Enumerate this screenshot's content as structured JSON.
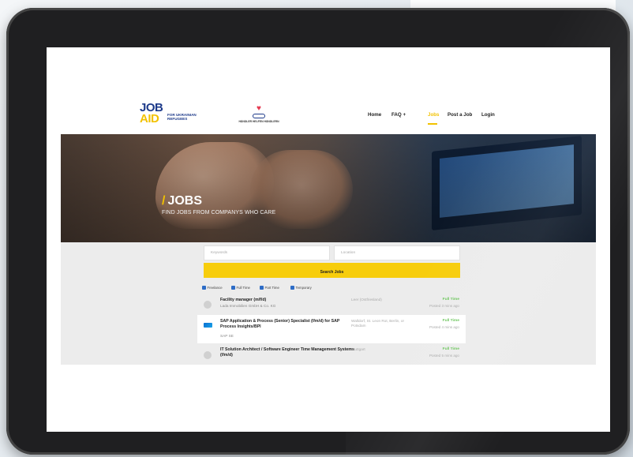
{
  "brand": {
    "logo_top": "JOB",
    "logo_bottom": "AID",
    "tagline_line1": "FOR UKRAINIAN",
    "tagline_line2": "REFUGEES",
    "partner_text": "HÄNDLER HELFEN HÄNDLERN",
    "accent_color": "#f2c200",
    "brand_color": "#1d3a8a"
  },
  "nav": {
    "items": [
      {
        "label": "Home"
      },
      {
        "label": "FAQ +"
      },
      {
        "label": "Jobs"
      },
      {
        "label": "Post a Job"
      },
      {
        "label": "Login"
      }
    ]
  },
  "hero": {
    "slash": "/",
    "title": "JOBS",
    "subtitle": "FIND JOBS FROM COMPANYS WHO CARE"
  },
  "search": {
    "keywords_placeholder": "Keywords",
    "location_placeholder": "Location",
    "button_label": "Search Jobs"
  },
  "filters": [
    {
      "label": "Freelance",
      "checked": true
    },
    {
      "label": "Full Time",
      "checked": true
    },
    {
      "label": "Part Time",
      "checked": true
    },
    {
      "label": "Temporary",
      "checked": true
    }
  ],
  "jobs": [
    {
      "title": "Facility manager (m/f/d)",
      "company": "Lada Immobilien GmbH & Co. KG",
      "location": "Leer (Ostfriesland)",
      "type": "Full Time",
      "posted": "Posted 3 mins ago",
      "logo_icon": "building-icon"
    },
    {
      "title": "SAP Application & Process (Senior) Specialist (f/m/d) for SAP Process Insights/BPI",
      "company": "SAP SE",
      "location": "Walldorf, St. Leon Rot, Berlin, or Potsdam",
      "type": "Full Time",
      "posted": "Posted 4 mins ago",
      "logo_icon": "sap-logo-icon"
    },
    {
      "title": "IT Solution Architect / Software Engineer Time Management Systems (f/m/d)",
      "company": "",
      "location": "Stuttgart",
      "type": "Full Time",
      "posted": "Posted 5 mins ago",
      "logo_icon": "building-icon"
    }
  ]
}
